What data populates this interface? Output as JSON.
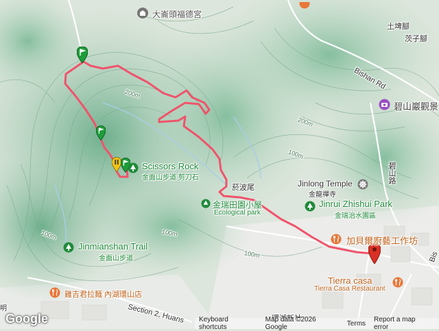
{
  "map": {
    "labels": {
      "temple_top": "大崙頭福德宮",
      "tuzhijiao": "土埤腳",
      "zhuzijiao": "茨子腳",
      "bishan_rd": "Bishan Rd",
      "bishanyan": "碧山巖觀景",
      "bishan_lu": "碧山路",
      "scissors_rock_en": "Scissors Rock",
      "scissors_rock_zh": "金面山步道 剪刀石",
      "jinrui_area_zh": "金瑞田園小屋",
      "ecological_park": "Ecological park",
      "jinlong_temple_en": "Jinlong Temple",
      "jinlong_temple_zh": "金龍禪寺",
      "jinrui_park_en": "Jinrui Zhishui Park",
      "jinrui_park_zh": "金瑞治水園區",
      "jinmianshan_en": "Jinmianshan Trail",
      "jinmianshan_zh": "金面山步道",
      "jiabei_workshop": "加貝爾廚藝工作坊",
      "tierra_en": "Tierra casa",
      "tierra_restaurant": "Tierra Casa Restaurant",
      "ramen": "雞吉君拉麵 內湖環山店",
      "section2": "Section 2, Huans",
      "area_label": "菸波尾",
      "bottom_text": "環湖新社",
      "edge_bis": "Bis",
      "contour_200_a": "200m",
      "contour_200_b": "200m",
      "contour_100_a": "100m",
      "contour_100_b": "100m",
      "contour_100_c": "100m",
      "contour_100_d": "100m",
      "left_edge": "明"
    },
    "colors": {
      "route": "#f0536b",
      "terrain_light": "#e8ede6",
      "terrain_mid": "#b9d6c2",
      "terrain_dark": "#7fb89a",
      "green_poi": "#1f8a3a",
      "orange_poi": "#e8783a",
      "purple_poi": "#9a4fc4",
      "marker_red": "#d93025"
    }
  },
  "footer": {
    "logo": "Google",
    "shortcuts": "Keyboard shortcuts",
    "map_data": "Map data ©2026 Google",
    "terms": "Terms",
    "report": "Report a map error"
  }
}
